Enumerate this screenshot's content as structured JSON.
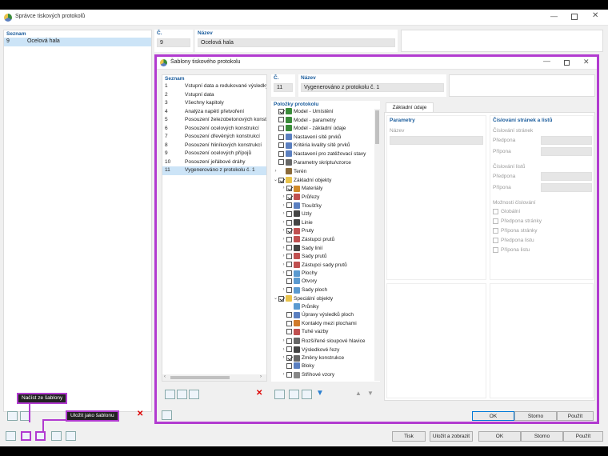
{
  "main": {
    "title": "Správce tiskových protokolů",
    "list_header": "Seznam",
    "list_items": [
      {
        "num": "9",
        "name": "Ocelová hala"
      }
    ],
    "num_header": "Č.",
    "num_value": "9",
    "name_header": "Název",
    "name_value": "Ocelová hala",
    "buttons": {
      "tisk": "Tisk",
      "save_show": "Uložit a zobrazit",
      "ok": "OK",
      "storno": "Storno",
      "apply": "Použít"
    }
  },
  "callouts": {
    "load": "Načíst ze šablony",
    "save": "Uložit jako šablonu"
  },
  "dialog": {
    "title": "Šablony tiskového protokolu",
    "list_header": "Seznam",
    "list_items": [
      {
        "num": "1",
        "name": "Vstupní data a redukované výsledky"
      },
      {
        "num": "2",
        "name": "Vstupní data"
      },
      {
        "num": "3",
        "name": "Všechny kapitoly"
      },
      {
        "num": "4",
        "name": "Analýza napětí přetvoření"
      },
      {
        "num": "5",
        "name": "Posouzení železobetonových konstrukcí"
      },
      {
        "num": "6",
        "name": "Posouzení ocelových konstrukcí"
      },
      {
        "num": "7",
        "name": "Posouzení dřevěných konstrukcí"
      },
      {
        "num": "8",
        "name": "Posouzení hliníkových konstrukcí"
      },
      {
        "num": "9",
        "name": "Posouzení ocelových přípojů"
      },
      {
        "num": "10",
        "name": "Posouzení jeřábové dráhy"
      },
      {
        "num": "11",
        "name": "Vygenerováno z protokolu č. 1"
      }
    ],
    "num_header": "Č.",
    "num_value": "11",
    "name_header": "Název",
    "name_value": "Vygenerováno z protokolu č. 1",
    "items_header": "Položky protokolu",
    "tree": [
      {
        "label": "Model - Umístění",
        "level": 0,
        "arrow": "",
        "checked": true,
        "icon": "#3a8c3a"
      },
      {
        "label": "Model - parametry",
        "level": 0,
        "arrow": "",
        "checked": false,
        "icon": "#3a8c3a"
      },
      {
        "label": "Model - základní údaje",
        "level": 0,
        "arrow": "",
        "checked": false,
        "icon": "#3a8c3a"
      },
      {
        "label": "Nastavení sítě prvků",
        "level": 0,
        "arrow": "",
        "checked": false,
        "icon": "#5a7fc0"
      },
      {
        "label": "Kritéria kvality sítě prvků",
        "level": 0,
        "arrow": "",
        "checked": false,
        "icon": "#5a7fc0"
      },
      {
        "label": "Nastavení pro zatěžovací stavy",
        "level": 0,
        "arrow": "",
        "checked": false,
        "icon": "#5a7fc0"
      },
      {
        "label": "Parametry skriptu/vzorce",
        "level": 0,
        "arrow": "",
        "checked": false,
        "icon": "#666666"
      },
      {
        "label": "Terén",
        "level": 0,
        "arrow": ">",
        "checked": null,
        "icon": "#8a6a3a"
      },
      {
        "label": "Základní objekty",
        "level": 0,
        "arrow": "v",
        "checked": true,
        "icon": "#e8c24a"
      },
      {
        "label": "Materiály",
        "level": 1,
        "arrow": ">",
        "checked": true,
        "icon": "#d08a2a"
      },
      {
        "label": "Průřezy",
        "level": 1,
        "arrow": ">",
        "checked": true,
        "icon": "#c05050"
      },
      {
        "label": "Tloušťky",
        "level": 1,
        "arrow": ">",
        "checked": false,
        "icon": "#5a7fc0"
      },
      {
        "label": "Uzly",
        "level": 1,
        "arrow": ">",
        "checked": false,
        "icon": "#444444"
      },
      {
        "label": "Linie",
        "level": 1,
        "arrow": ">",
        "checked": false,
        "icon": "#444444"
      },
      {
        "label": "Pruty",
        "level": 1,
        "arrow": ">",
        "checked": true,
        "icon": "#c05050"
      },
      {
        "label": "Zástupci prutů",
        "level": 1,
        "arrow": ">",
        "checked": false,
        "icon": "#c05050"
      },
      {
        "label": "Sady linií",
        "level": 1,
        "arrow": ">",
        "checked": false,
        "icon": "#444444"
      },
      {
        "label": "Sady prutů",
        "level": 1,
        "arrow": ">",
        "checked": false,
        "icon": "#c05050"
      },
      {
        "label": "Zástupci sady prutů",
        "level": 1,
        "arrow": ">",
        "checked": false,
        "icon": "#c05050"
      },
      {
        "label": "Plochy",
        "level": 1,
        "arrow": ">",
        "checked": false,
        "icon": "#5a9ad0"
      },
      {
        "label": "Otvory",
        "level": 1,
        "arrow": "",
        "checked": false,
        "icon": "#5a9ad0"
      },
      {
        "label": "Sady ploch",
        "level": 1,
        "arrow": ">",
        "checked": false,
        "icon": "#5a9ad0"
      },
      {
        "label": "Speciální objekty",
        "level": 0,
        "arrow": "v",
        "checked": true,
        "icon": "#e8c24a"
      },
      {
        "label": "Průniky",
        "level": 1,
        "arrow": "",
        "checked": null,
        "icon": "#5a9ad0"
      },
      {
        "label": "Úpravy výsledků ploch",
        "level": 1,
        "arrow": "",
        "checked": false,
        "icon": "#5a7fc0"
      },
      {
        "label": "Kontakty mezi plochami",
        "level": 1,
        "arrow": "",
        "checked": false,
        "icon": "#d07a2a"
      },
      {
        "label": "Tuhé vazby",
        "level": 1,
        "arrow": "",
        "checked": false,
        "icon": "#c05050"
      },
      {
        "label": "Rozšířené sloupové hlavice",
        "level": 1,
        "arrow": ">",
        "checked": false,
        "icon": "#666666"
      },
      {
        "label": "Výsledkové řezy",
        "level": 1,
        "arrow": ">",
        "checked": false,
        "icon": "#444444"
      },
      {
        "label": "Změny konstrukce",
        "level": 1,
        "arrow": ">",
        "checked": true,
        "icon": "#666666"
      },
      {
        "label": "Bloky",
        "level": 1,
        "arrow": "",
        "checked": false,
        "icon": "#5a7fc0"
      },
      {
        "label": "Střihové vzory",
        "level": 1,
        "arrow": ">",
        "checked": false,
        "icon": "#888888"
      }
    ],
    "tab": "Základní údaje",
    "params_header": "Parametry",
    "params_name_label": "Název",
    "numbering_header": "Číslování stránek a listů",
    "page_numbering": "Číslování stránek",
    "prefix": "Předpona",
    "suffix": "Přípona",
    "sheet_numbering": "Číslování listů",
    "options_header": "Možnosti číslování",
    "options": [
      "Globální",
      "Předpona stránky",
      "Přípona stránky",
      "Předpona listu",
      "Přípona listu"
    ],
    "buttons": {
      "ok": "OK",
      "storno": "Storno",
      "apply": "Použít"
    }
  }
}
